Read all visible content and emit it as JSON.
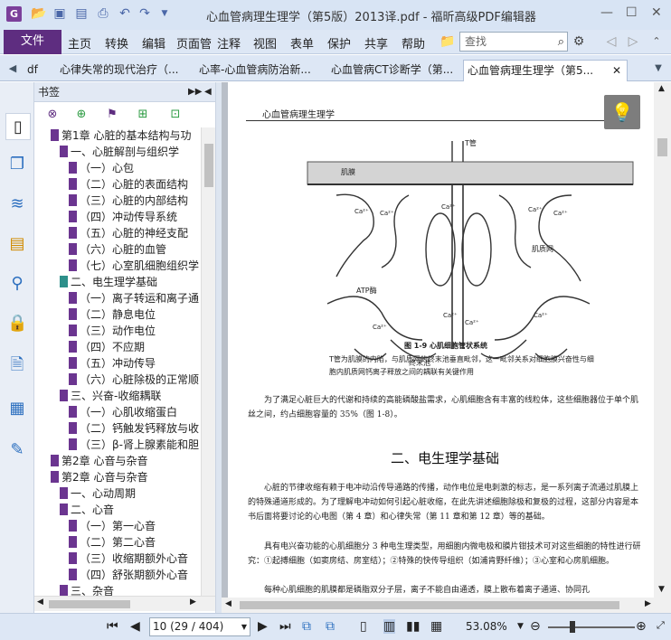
{
  "app": {
    "logo_letter": "G",
    "title": "心血管病理生理学（第5版）2013译.pdf - 福昕高级PDF编辑器",
    "quick_access": [
      "folder-icon",
      "save-icon",
      "save-as-icon",
      "print-icon",
      "undo-icon",
      "redo-icon",
      "dropdown-icon"
    ],
    "window_buttons": {
      "min": "—",
      "max": "☐",
      "close": "✕"
    }
  },
  "menubar": {
    "file_label": "文件",
    "items": [
      "主页",
      "转换",
      "编辑",
      "页面管",
      "注释",
      "视图",
      "表单",
      "保护",
      "共享",
      "帮助"
    ],
    "search_placeholder": "查找"
  },
  "tabs": [
    {
      "label": "df"
    },
    {
      "label": "心律失常的现代治疗（..."
    },
    {
      "label": "心率-心血管病防治新..."
    },
    {
      "label": "心血管病CT诊断学（第..."
    },
    {
      "label": "心血管病理生理学（第5..."
    }
  ],
  "bookmarks": {
    "header": "书签",
    "items": [
      {
        "label": "第1章  心脏的基本结构与功",
        "level": 0,
        "flag": "purple"
      },
      {
        "label": "一、心脏解剖与组织学",
        "level": 1,
        "flag": "purple"
      },
      {
        "label": "（一）心包",
        "level": 2,
        "flag": "purple"
      },
      {
        "label": "（二）心脏的表面结构",
        "level": 2,
        "flag": "purple"
      },
      {
        "label": "（三）心脏的内部结构",
        "level": 2,
        "flag": "purple"
      },
      {
        "label": "（四）冲动传导系统",
        "level": 2,
        "flag": "purple"
      },
      {
        "label": "（五）心脏的神经支配",
        "level": 2,
        "flag": "purple"
      },
      {
        "label": "（六）心脏的血管",
        "level": 2,
        "flag": "purple"
      },
      {
        "label": "（七）心室肌细胞组织学",
        "level": 2,
        "flag": "purple"
      },
      {
        "label": "二、电生理学基础",
        "level": 1,
        "flag": "teal"
      },
      {
        "label": "（一）离子转运和离子通",
        "level": 2,
        "flag": "purple"
      },
      {
        "label": "（二）静息电位",
        "level": 2,
        "flag": "purple"
      },
      {
        "label": "（三）动作电位",
        "level": 2,
        "flag": "purple"
      },
      {
        "label": "（四）不应期",
        "level": 2,
        "flag": "purple"
      },
      {
        "label": "（五）冲动传导",
        "level": 2,
        "flag": "purple"
      },
      {
        "label": "（六）心脏除极的正常顺",
        "level": 2,
        "flag": "purple"
      },
      {
        "label": "三、兴奋-收缩耦联",
        "level": 1,
        "flag": "purple"
      },
      {
        "label": "（一）心肌收缩蛋白",
        "level": 2,
        "flag": "purple"
      },
      {
        "label": "（二）钙触发钙释放与收",
        "level": 2,
        "flag": "purple"
      },
      {
        "label": "（三）β-肾上腺素能和胆",
        "level": 2,
        "flag": "purple"
      },
      {
        "label": "第2章  心音与杂音",
        "level": 0,
        "flag": "purple"
      },
      {
        "label": "第2章  心音与杂音",
        "level": 0,
        "flag": "purple"
      },
      {
        "label": "一、心动周期",
        "level": 1,
        "flag": "purple"
      },
      {
        "label": "二、心音",
        "level": 1,
        "flag": "purple"
      },
      {
        "label": "（一）第一心音",
        "level": 2,
        "flag": "purple"
      },
      {
        "label": "（二）第二心音",
        "level": 2,
        "flag": "purple"
      },
      {
        "label": "（三）收缩期额外心音",
        "level": 2,
        "flag": "purple"
      },
      {
        "label": "（四）舒张期额外心音",
        "level": 2,
        "flag": "purple"
      },
      {
        "label": "三、杂音",
        "level": 1,
        "flag": "purple"
      }
    ]
  },
  "document": {
    "running_header": "心血管病理生理学",
    "figure": {
      "labels": [
        "T管",
        "肌膜",
        "Ca²⁺",
        "Ca²⁺",
        "Ca²⁺",
        "Ca²⁺",
        "Ca²⁺",
        "肌质网",
        "ATP酶",
        "Ca²⁺",
        "Ca²⁺",
        "Ca²⁺",
        "Ca²⁺",
        "终末池"
      ],
      "caption": "图 1-9  心肌细胞管状系统",
      "note": "T管为肌膜的内陷，与肌质网的终末池垂直毗邻，这一毗邻关系对细胞膜兴奋性与细胞内肌质网钙离子释放之间的耦联有关键作用"
    },
    "para1": "为了满足心脏巨大的代谢和持续的高能磷酸盐需求，心肌细胞含有丰富的线粒体，这些细胞器位于单个肌丝之间，约占细胞容量的 35%（图 1-8）。",
    "section_title": "二、电生理学基础",
    "para2": "心脏的节律收缩有赖于电冲动沿传导通路的传播，动作电位是电刺激的标志，是一系列离子流通过肌膜上的特殊通道形成的。为了理解电冲动如何引起心脏收缩，在此先讲述细胞除极和复极的过程，这部分内容是本书后面将要讨论的心电图（第 4 章）和心律失常（第 11 章和第 12 章）等的基础。",
    "para3": "具有电兴奋功能的心肌细胞分 3 种电生理类型，用细胞内微电极和膜片钳技术可对这些细胞的特性进行研究：①起搏细胞（如窦房结、房室结）；②特殊的快传导组织（如浦肯野纤维）；③心室和心房肌细胞。",
    "para4": "每种心肌细胞的肌膜都是磷脂双分子层，离子不能自由通透，膜上散布着离子通道、协同孔"
  },
  "status": {
    "page_field": "10 (29 / 404)",
    "zoom": "53.08%"
  },
  "colors": {
    "brand": "#5e2d80",
    "bookmark_flag": "#6b3590",
    "bookmark_flag_active": "#2d8f8a"
  }
}
